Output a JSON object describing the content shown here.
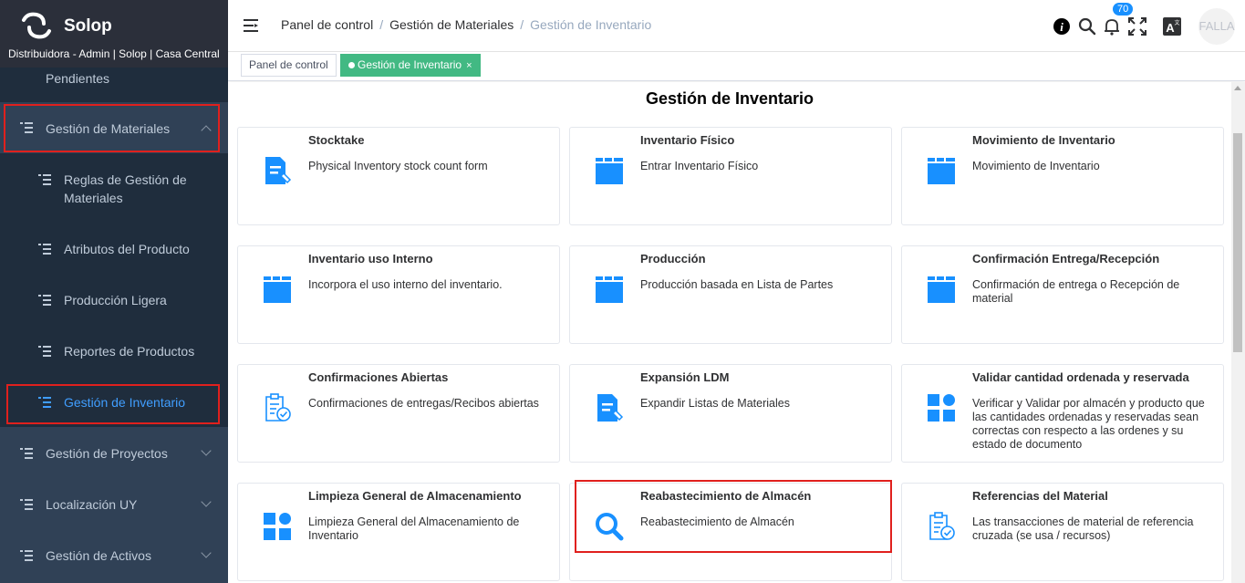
{
  "brand": {
    "name": "Solop",
    "subtitle": "Distribuidora - Admin | Solop | Casa Central"
  },
  "sidebar": {
    "partial_item": "Pendientes",
    "items": [
      {
        "label": "Gestión de Materiales",
        "icon": "list-icon",
        "expanded": true
      },
      {
        "label": "Reglas de Gestión de Materiales",
        "icon": "list-icon"
      },
      {
        "label": "Atributos del Producto",
        "icon": "list-icon"
      },
      {
        "label": "Producción Ligera",
        "icon": "list-icon"
      },
      {
        "label": "Reportes de Productos",
        "icon": "list-icon"
      },
      {
        "label": "Gestión de Inventario",
        "icon": "list-icon",
        "active": true
      },
      {
        "label": "Gestión de Proyectos",
        "icon": "list-icon"
      },
      {
        "label": "Localización UY",
        "icon": "list-icon"
      },
      {
        "label": "Gestión de Activos",
        "icon": "list-icon"
      }
    ]
  },
  "header": {
    "breadcrumbs": [
      "Panel de control",
      "Gestión de Materiales",
      "Gestión de Inventario"
    ],
    "notification_count": "70",
    "avatar_text": "FALLA"
  },
  "tags": [
    {
      "label": "Panel de control"
    },
    {
      "label": "Gestión de Inventario",
      "active": true,
      "close": "×"
    }
  ],
  "main": {
    "title": "Gestión de Inventario",
    "cards": [
      {
        "title": "Stocktake",
        "desc": "Physical Inventory stock count form",
        "icon": "form-edit-icon"
      },
      {
        "title": "Inventario Físico",
        "desc": "Entrar Inventario Físico",
        "icon": "folder-icon"
      },
      {
        "title": "Movimiento de Inventario",
        "desc": "Movimiento de Inventario",
        "icon": "folder-icon"
      },
      {
        "title": "Inventario uso Interno",
        "desc": "Incorpora el uso interno del inventario.",
        "icon": "folder-icon"
      },
      {
        "title": "Producción",
        "desc": "Producción basada en Lista de Partes",
        "icon": "folder-icon"
      },
      {
        "title": "Confirmación Entrega/Recepción",
        "desc": "Confirmación de entrega o Recepción de material",
        "icon": "folder-icon"
      },
      {
        "title": "Confirmaciones Abiertas",
        "desc": "Confirmaciones de entregas/Recibos abiertas",
        "icon": "clipboard-check-icon"
      },
      {
        "title": "Expansión LDM",
        "desc": "Expandir Listas de Materiales",
        "icon": "form-edit-icon"
      },
      {
        "title": "Validar cantidad ordenada y reservada",
        "desc": "Verificar y Validar por almacén y producto que las cantidades ordenadas y reservadas sean correctas con respecto a las ordenes y su estado de documento",
        "icon": "grid-icon"
      },
      {
        "title": "Limpieza General de Almacenamiento",
        "desc": "Limpieza General del Almacenamiento de Inventario",
        "icon": "grid-icon"
      },
      {
        "title": "Reabastecimiento de Almacén",
        "desc": "Reabastecimiento de Almacén",
        "icon": "search-icon"
      },
      {
        "title": "Referencias del Material",
        "desc": "Las transacciones de material de referencia cruzada (se usa / recursos)",
        "icon": "clipboard-check-icon"
      }
    ]
  },
  "colors": {
    "sidebar_bg": "#304156",
    "brand_bg": "#2b2f3a",
    "active_text": "#409eff",
    "accent_icon": "#1890ff",
    "highlight_border": "#e0201d",
    "tag_active": "#42b983"
  }
}
